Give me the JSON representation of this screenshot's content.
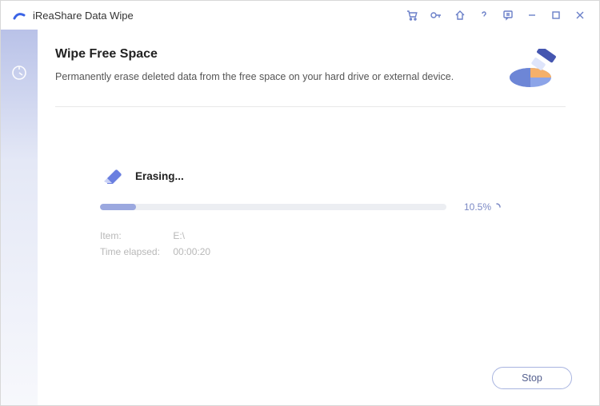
{
  "app": {
    "title": "iReaShare Data Wipe"
  },
  "header": {
    "title": "Wipe Free Space",
    "subtitle": "Permanently erase deleted data from the free space on your hard drive or external device."
  },
  "progress": {
    "status": "Erasing...",
    "percent": 10.5,
    "percent_text": "10.5%",
    "item_label": "Item:",
    "item_value": "E:\\",
    "time_label": "Time elapsed:",
    "time_value": "00:00:20"
  },
  "actions": {
    "stop": "Stop"
  },
  "colors": {
    "accent": "#8a9ad8",
    "progress_fill": "#9ba8df",
    "progress_track": "#eceef2"
  }
}
